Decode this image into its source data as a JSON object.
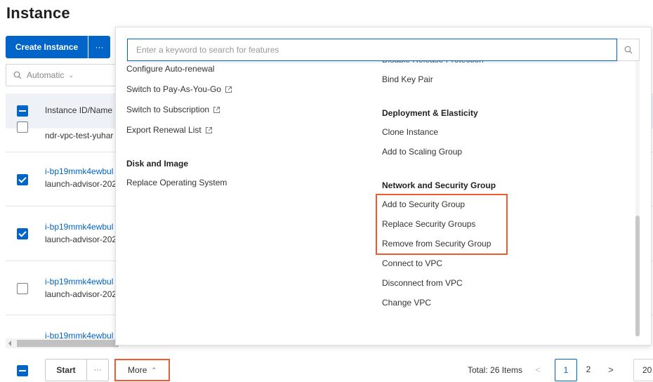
{
  "page": {
    "title": "Instance"
  },
  "toolbar": {
    "create_label": "Create Instance",
    "create_more_label": "···",
    "filter_label": "Automatic"
  },
  "table": {
    "header": {
      "id_name": "Instance ID/Name"
    },
    "rows": [
      {
        "id": "",
        "name": "ndr-vpc-test-yuhar",
        "checked": false,
        "partial": true
      },
      {
        "id": "i-bp19mmk4ewbul",
        "name": "launch-advisor-202",
        "checked": true
      },
      {
        "id": "i-bp19mmk4ewbul",
        "name": "launch-advisor-202",
        "checked": true
      },
      {
        "id": "i-bp19mmk4ewbul",
        "name": "launch-advisor-202",
        "checked": false
      },
      {
        "id": "i-bp19mmk4ewbul",
        "name": "",
        "checked": false,
        "partial": true
      }
    ]
  },
  "footer": {
    "start_label": "Start",
    "dots_label": "···",
    "more_label": "More",
    "more_caret": "^",
    "total_label": "Total: 26 Items",
    "prev": "<",
    "next": ">",
    "pages": [
      "1",
      "2"
    ],
    "current_page": "1",
    "page_size": "20"
  },
  "dropdown": {
    "search_placeholder": "Enter a keyword to search for features",
    "left_column": {
      "items_top": [
        {
          "label": "Configure Auto-renewal",
          "external": false
        },
        {
          "label": "Switch to Pay-As-You-Go",
          "external": true
        },
        {
          "label": "Switch to Subscription",
          "external": true
        },
        {
          "label": "Export Renewal List",
          "external": true
        }
      ],
      "group_disk": {
        "title": "Disk and Image",
        "items": [
          {
            "label": "Replace Operating System"
          }
        ]
      }
    },
    "right_column": {
      "cut_item": "Disable Release Protection",
      "items_top": [
        {
          "label": "Bind Key Pair"
        }
      ],
      "group_deploy": {
        "title": "Deployment & Elasticity",
        "items": [
          {
            "label": "Clone Instance"
          },
          {
            "label": "Add to Scaling Group"
          }
        ]
      },
      "group_network": {
        "title": "Network and Security Group",
        "items": [
          {
            "label": "Add to Security Group",
            "highlighted": true
          },
          {
            "label": "Replace Security Groups",
            "highlighted": true
          },
          {
            "label": "Remove from Security Group",
            "highlighted": true
          },
          {
            "label": "Connect to VPC"
          },
          {
            "label": "Disconnect from VPC"
          },
          {
            "label": "Change VPC"
          }
        ]
      }
    }
  },
  "colors": {
    "primary": "#0064c8",
    "highlight": "#f05a30",
    "header_bg": "#eef1f6"
  }
}
